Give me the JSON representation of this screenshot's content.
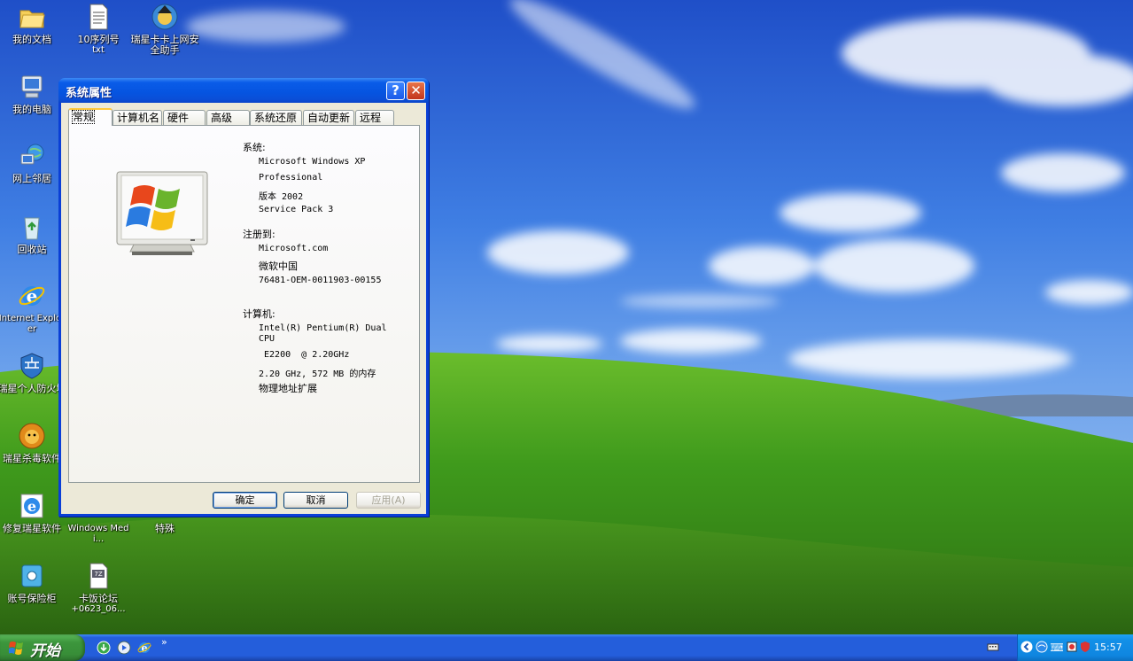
{
  "desktop": {
    "icons": [
      {
        "label": "我的文档"
      },
      {
        "label": "10序列号",
        "sub": "txt"
      },
      {
        "label": "瑞星卡卡上网安全助手"
      },
      {
        "label": "我的电脑"
      },
      {
        "label": "网上邻居"
      },
      {
        "label": "回收站"
      },
      {
        "label": "Internet Explorer"
      },
      {
        "label": "瑞星个人防火墙"
      },
      {
        "label": "瑞星杀毒软件"
      },
      {
        "label": "修复瑞星软件"
      },
      {
        "label": "Windows Medi..."
      },
      {
        "label": "特殊"
      },
      {
        "label": "账号保险柜"
      },
      {
        "label": "卡饭论坛",
        "sub": "+0623_06..."
      }
    ]
  },
  "window": {
    "title": "系统属性",
    "tabs": [
      "常规",
      "计算机名",
      "硬件",
      "高级",
      "系统还原",
      "自动更新",
      "远程"
    ],
    "active_tab": "常规",
    "system": {
      "heading": "系统:",
      "lines": [
        "Microsoft Windows XP",
        "Professional",
        "版本 2002",
        "Service Pack 3"
      ]
    },
    "registered": {
      "heading": "注册到:",
      "lines": [
        "Microsoft.com",
        "微软中国",
        "76481-OEM-0011903-00155"
      ]
    },
    "computer": {
      "heading": "计算机:",
      "lines": [
        "Intel(R) Pentium(R) Dual",
        "CPU",
        " E2200  @ 2.20GHz",
        "2.20 GHz, 572 MB 的内存",
        "物理地址扩展"
      ]
    },
    "buttons": {
      "ok": "确定",
      "cancel": "取消",
      "apply": "应用(A)"
    }
  },
  "taskbar": {
    "start_label": "开始",
    "quick_launch_more": "»",
    "clock": "15:57"
  },
  "colors": {
    "titlebar": "#0a5ce8",
    "start": "#3c963c",
    "taskbar": "#245edb",
    "tray": "#0f86e0",
    "dialog_bg": "#ece9d8"
  }
}
